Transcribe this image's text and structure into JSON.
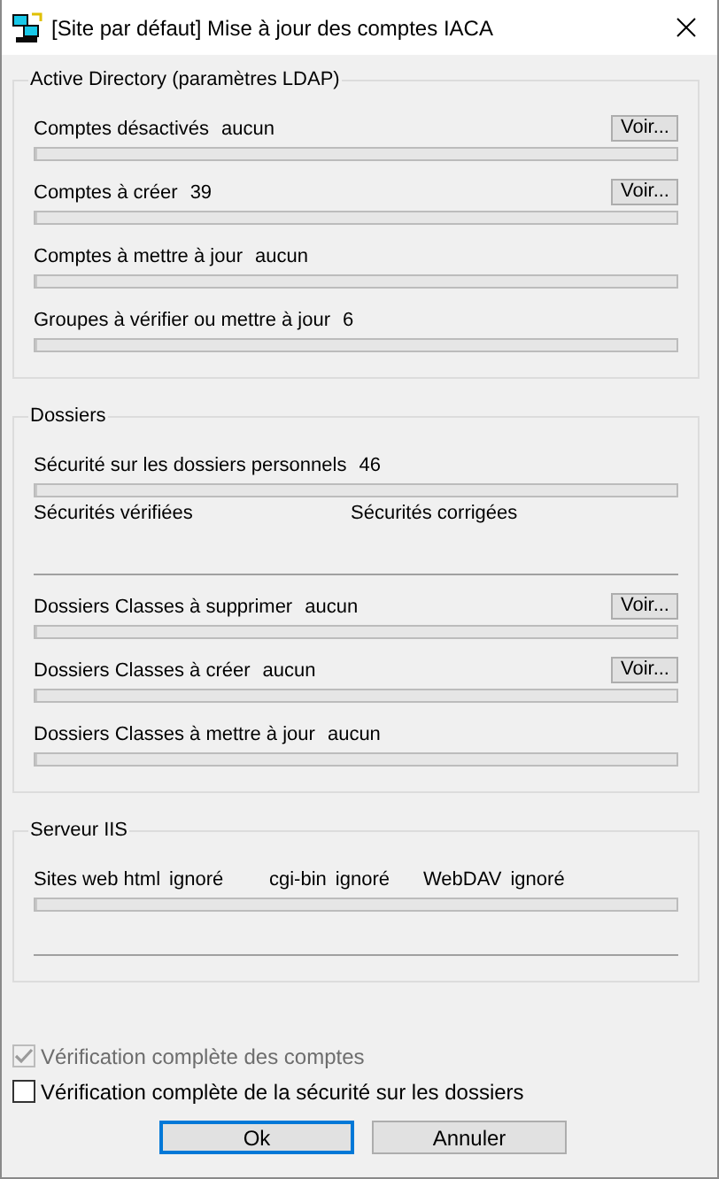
{
  "window": {
    "title": "[Site par défaut] Mise à jour des comptes IACA"
  },
  "groups": [
    {
      "title": "Active Directory (paramètres LDAP)",
      "items": [
        {
          "kind": "counter",
          "label": "Comptes désactivés",
          "value": "aucun",
          "button": "Voir...",
          "level": 0
        },
        {
          "kind": "counter",
          "label": "Comptes à créer",
          "value": "39",
          "button": "Voir...",
          "level": 0
        },
        {
          "kind": "counter",
          "label": "Comptes à mettre à jour",
          "value": "aucun",
          "level": 0
        },
        {
          "kind": "counter",
          "label": "Groupes à vérifier ou mettre à jour",
          "value": "6",
          "level": 0
        }
      ]
    },
    {
      "title": "Dossiers",
      "items": [
        {
          "kind": "security",
          "label": "Sécurité sur les dossiers personnels",
          "value": "46",
          "level": 0,
          "checked_label": "Sécurités vérifiées",
          "fixed_label": "Sécurités corrigées"
        },
        {
          "kind": "counter",
          "label": "Dossiers Classes à supprimer",
          "value": "aucun",
          "button": "Voir...",
          "level": 0
        },
        {
          "kind": "counter",
          "label": "Dossiers Classes à créer",
          "value": "aucun",
          "button": "Voir...",
          "level": 0
        },
        {
          "kind": "counter",
          "label": "Dossiers Classes à mettre à jour",
          "value": "aucun",
          "level": 0
        }
      ]
    },
    {
      "title": "Serveur IIS",
      "items": [
        {
          "kind": "services",
          "entries": [
            {
              "label": "Sites web html",
              "value": "ignoré"
            },
            {
              "label": "cgi-bin",
              "value": "ignoré"
            },
            {
              "label": "WebDAV",
              "value": "ignoré"
            }
          ],
          "level": 0
        }
      ]
    }
  ],
  "options": [
    {
      "label": "Vérification complète des comptes",
      "checked": true,
      "disabled": true
    },
    {
      "label": "Vérification complète de la sécurité sur les dossiers",
      "checked": false,
      "disabled": false
    }
  ],
  "buttons": [
    {
      "label": "Ok",
      "default": true
    },
    {
      "label": "Annuler",
      "default": false
    }
  ]
}
